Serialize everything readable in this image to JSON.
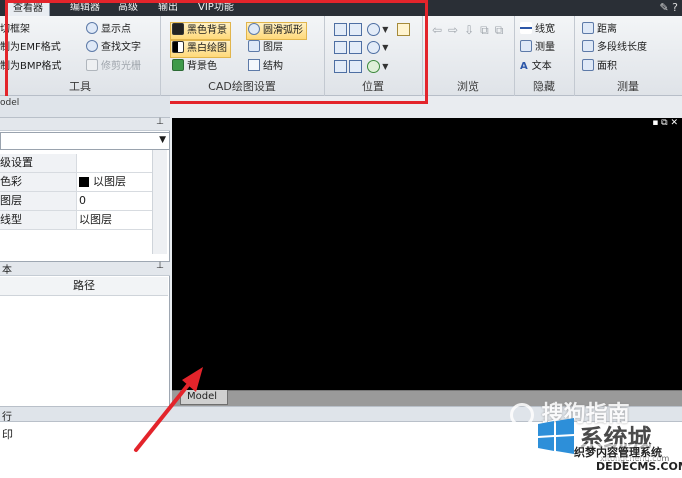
{
  "tabs": [
    "查看器",
    "编辑器",
    "高级",
    "输出",
    "VIP功能"
  ],
  "ribbon": {
    "tools": {
      "label": "工具",
      "col1": [
        "切框架",
        "制为EMF格式",
        "制为BMP格式"
      ],
      "col2": [
        "显示点",
        "查找文字",
        "修剪光栅"
      ]
    },
    "cad": {
      "label": "CAD绘图设置",
      "col1": [
        "黑色背景",
        "黑白绘图",
        "背景色"
      ],
      "col2": [
        "圆滑弧形",
        "图层",
        "结构"
      ]
    },
    "position": {
      "label": "位置"
    },
    "browse": {
      "label": "浏览"
    },
    "hide": {
      "label": "隐藏",
      "items": [
        "线宽",
        "测量",
        "文本"
      ]
    },
    "measure": {
      "label": "测量",
      "items": [
        "距离",
        "多段线长度",
        "面积"
      ]
    }
  },
  "left_panel": {
    "header_tag": "odel",
    "combo_value": "",
    "properties": [
      {
        "key": "级设置",
        "value": ""
      },
      {
        "key": "色彩",
        "value": "以图层"
      },
      {
        "key": "图层",
        "value": "0"
      },
      {
        "key": "线型",
        "value": "以图层"
      }
    ],
    "bottom_title": "本",
    "bottom_column": "路径"
  },
  "canvas": {
    "tab": "Model"
  },
  "command": {
    "header": "行",
    "text": "印"
  },
  "watermarks": {
    "sogou": "搜狗指南",
    "xitong": "系统城",
    "xitong_url": "xitongcheng.com",
    "dede_line1": "织梦内容管理系统",
    "dede_line2": "DEDECMS.COM"
  }
}
